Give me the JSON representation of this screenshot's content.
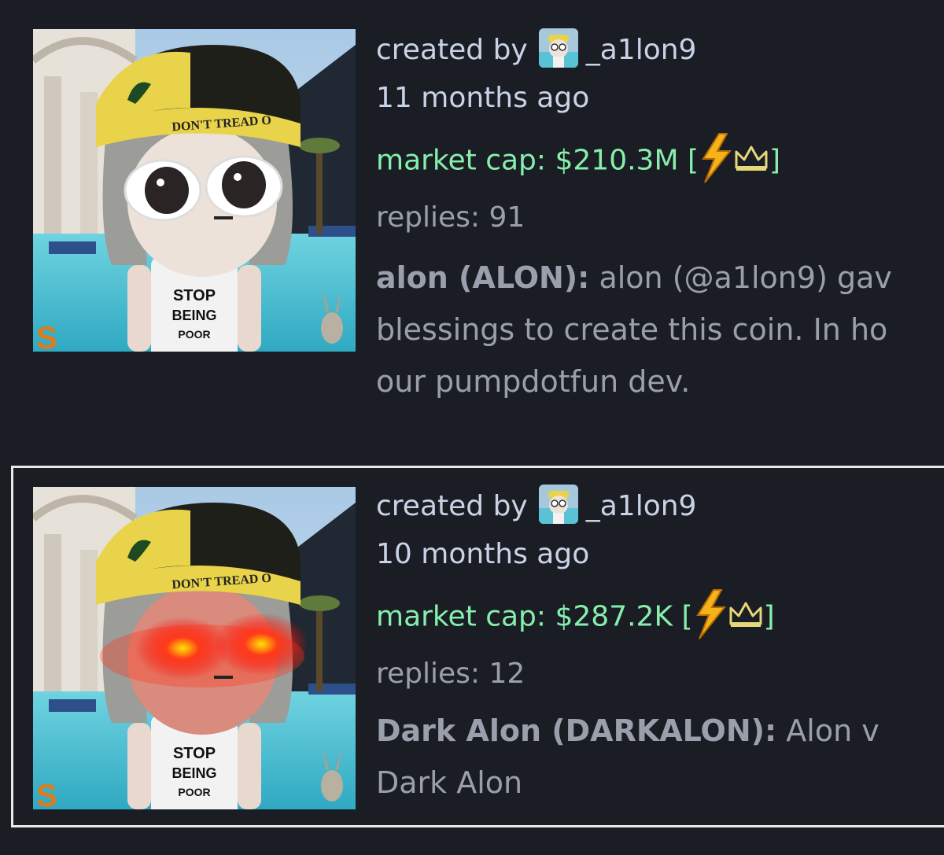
{
  "cards": [
    {
      "creator_prefix": "created by",
      "creator_name": "_a1lon9",
      "age": "11 months ago",
      "market_cap": "market cap: $210.3M",
      "bracket_open": "[",
      "bracket_close": "]",
      "badges": [
        "lightning-bolt-icon",
        "crown-icon"
      ],
      "replies": "replies: 91",
      "coin_title": "alon (ALON):",
      "description_lines": [
        " alon (@a1lon9) gav",
        "blessings to create this coin. In ho",
        "our pumpdotfun dev."
      ],
      "image_text": {
        "cap": "DON'T TREAD O",
        "shirt": [
          "STOP",
          "BEING",
          "POOR"
        ],
        "logo": "S"
      }
    },
    {
      "creator_prefix": "created by",
      "creator_name": "_a1lon9",
      "age": "10 months ago",
      "market_cap": "market cap: $287.2K",
      "bracket_open": "[",
      "bracket_close": "]",
      "badges": [
        "lightning-bolt-icon",
        "crown-icon"
      ],
      "replies": "replies: 12",
      "coin_title": "Dark Alon (DARKALON):",
      "description_lines": [
        " Alon v",
        "Dark Alon"
      ],
      "image_text": {
        "cap": "DON'T TREAD O",
        "shirt": [
          "STOP",
          "BEING",
          "POOR"
        ],
        "logo": "S"
      }
    }
  ],
  "colors": {
    "background": "#1b1d24",
    "text": "#c9d3e8",
    "market_cap": "#86efac",
    "muted": "#9aa0ab",
    "selected_border": "#e8e8e8"
  }
}
